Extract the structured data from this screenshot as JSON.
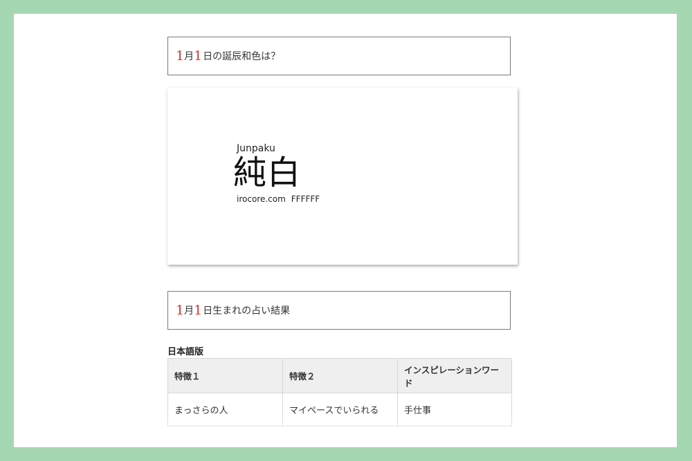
{
  "heading1": {
    "month_num": "1",
    "month_unit": "月",
    "day_num": "1",
    "rest": "日の誕辰和色は？"
  },
  "color_card": {
    "romaji": "Junpaku",
    "kanji": "純白",
    "site": "irocore.com",
    "hex_code": "FFFFFF",
    "background_color": "#ffffff"
  },
  "heading2": {
    "month_num": "1",
    "month_unit": "月",
    "day_num": "1",
    "rest": "日生まれの占い結果"
  },
  "section": {
    "label": "日本語版"
  },
  "table": {
    "headers": [
      "特徴１",
      "特徴２",
      "インスピレーションワード"
    ],
    "rows": [
      [
        "まっさらの人",
        "マイペースでいられる",
        "手仕事"
      ]
    ]
  },
  "colors": {
    "frame": "#a6d7b3",
    "accent_number": "#e0322f"
  }
}
